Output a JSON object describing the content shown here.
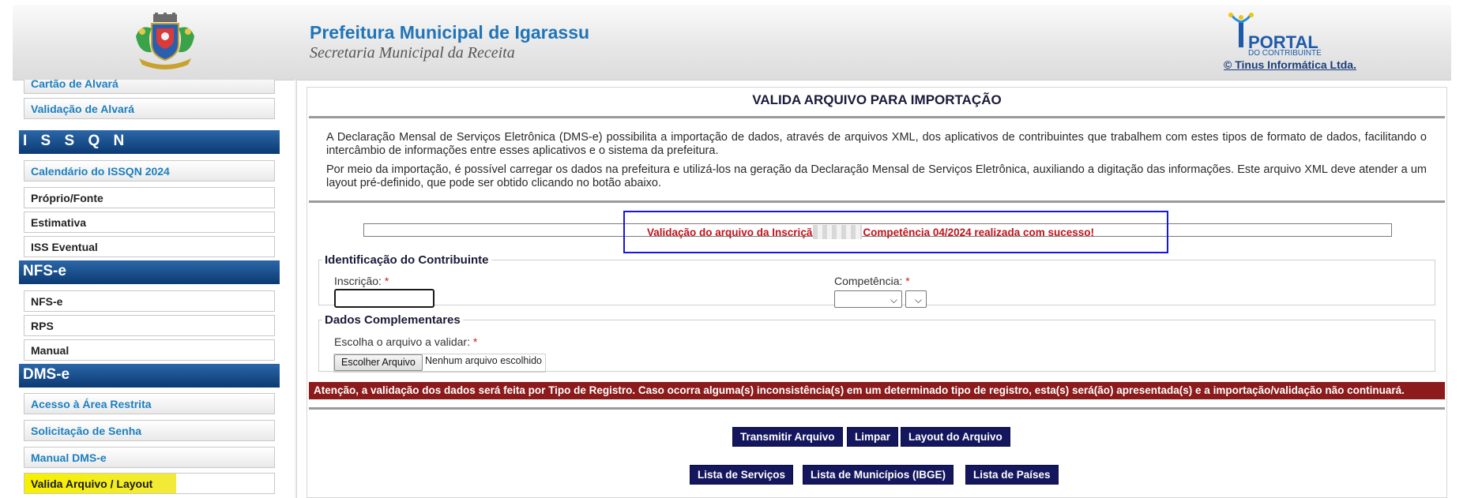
{
  "header": {
    "title": "Prefeitura Municipal de Igarassu",
    "subtitle": "Secretaria Municipal da Receita",
    "portal_logo_word": "PORTAL",
    "portal_logo_sub": "DO CONTRIBUINTE",
    "vendor_link": "© Tinus Informática Ltda."
  },
  "sidebar": {
    "items": [
      {
        "label": "Cartão de Alvará",
        "style": "link"
      },
      {
        "label": "Validação de Alvará",
        "style": "link"
      },
      {
        "label": "I S S Q N",
        "style": "heading"
      },
      {
        "label": "Calendário do ISSQN 2024",
        "style": "link"
      },
      {
        "label": "Próprio/Fonte",
        "style": "plain"
      },
      {
        "label": "Estimativa",
        "style": "plain"
      },
      {
        "label": "ISS Eventual",
        "style": "plain"
      },
      {
        "label": "NFS-e",
        "style": "heading"
      },
      {
        "label": "NFS-e",
        "style": "plain"
      },
      {
        "label": "RPS",
        "style": "plain"
      },
      {
        "label": "Manual",
        "style": "plain"
      },
      {
        "label": "DMS-e",
        "style": "heading"
      },
      {
        "label": "Acesso à Área Restrita",
        "style": "link"
      },
      {
        "label": "Solicitação de Senha",
        "style": "link"
      },
      {
        "label": "Manual DMS-e",
        "style": "link"
      },
      {
        "label": "Valida Arquivo / Layout",
        "style": "active"
      }
    ]
  },
  "main": {
    "title": "VALIDA ARQUIVO PARA IMPORTAÇÃO",
    "intro_p1": "A Declaração Mensal de Serviços Eletrônica (DMS-e) possibilita a importação de dados, através de arquivos XML, dos aplicativos de contribuintes que trabalhem com estes tipos de formato de dados, facilitando o intercâmbio de informações entre esses aplicativos e o sistema da prefeitura.",
    "intro_p2": "Por meio da importação, é possível carregar os dados na prefeitura e utilizá-los na geração da Declaração Mensal de Serviços Eletrônica, auxiliando a digitação das informações. Este arquivo XML deve atender a um layout pré-definido, que pode ser obtido clicando no botão abaixo.",
    "success_before": "Validação do arquivo da Inscriçã",
    "success_after": "Competência 04/2024 realizada com sucesso!",
    "identificacao": {
      "legend": "Identificação do Contribuinte",
      "inscricao_label": "Inscrição:",
      "inscricao_value": "",
      "competencia_label": "Competência:",
      "required_mark": "*"
    },
    "complementares": {
      "legend": "Dados Complementares",
      "file_label": "Escolha o arquivo a validar:",
      "file_button": "Escolher Arquivo",
      "file_status": "Nenhum arquivo escolhido"
    },
    "warning": "Atenção, a validação dos dados será feita por Tipo de Registro. Caso ocorra alguma(s) inconsistência(s) em um determinado tipo de registro, esta(s) será(ão) apresentada(s) e a importação/validação não continuará.",
    "buttons_row1": [
      "Transmitir Arquivo",
      "Limpar",
      "Layout do Arquivo"
    ],
    "buttons_row2": [
      "Lista de Serviços",
      "Lista de Municípios (IBGE)",
      "Lista de Países"
    ]
  }
}
